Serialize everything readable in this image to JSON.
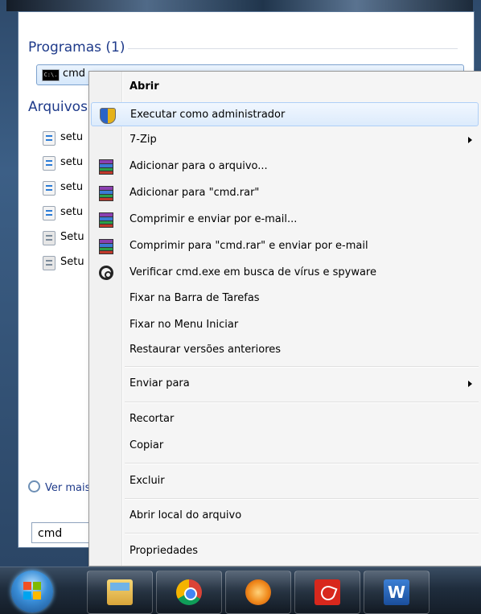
{
  "start_menu": {
    "programs_header": "Programas (1)",
    "files_header": "Arquivos",
    "program_item": "cmd",
    "program_icon_text": "C:\\.",
    "files": [
      "setu",
      "setu",
      "setu",
      "setu",
      "Setu",
      "Setu"
    ],
    "see_more": "Ver mais",
    "search_value": "cmd"
  },
  "context_menu": {
    "items": [
      {
        "label": "Abrir",
        "bold": true,
        "icon": null
      },
      {
        "label": "Executar como administrador",
        "icon": "uac-shield-icon",
        "highlighted": true
      },
      {
        "label": "7-Zip",
        "submenu": true,
        "icon": null
      },
      {
        "label": "Adicionar para o arquivo...",
        "icon": "winrar-icon"
      },
      {
        "label": "Adicionar para \"cmd.rar\"",
        "icon": "winrar-icon"
      },
      {
        "label": "Comprimir e enviar por e-mail...",
        "icon": "winrar-icon"
      },
      {
        "label": "Comprimir para \"cmd.rar\" e enviar por e-mail",
        "icon": "winrar-icon"
      },
      {
        "label": "Verificar cmd.exe em busca de vírus e spyware",
        "icon": "avg-icon"
      },
      {
        "label": "Fixar na Barra de Tarefas",
        "icon": null
      },
      {
        "label": "Fixar no Menu Iniciar",
        "icon": null
      },
      {
        "label": "Restaurar versões anteriores",
        "icon": null
      },
      {
        "label": "Enviar para",
        "submenu": true,
        "icon": null
      },
      {
        "label": "Recortar",
        "icon": null
      },
      {
        "label": "Copiar",
        "icon": null
      },
      {
        "label": "Excluir",
        "icon": null
      },
      {
        "label": "Abrir local do arquivo",
        "icon": null
      },
      {
        "label": "Propriedades",
        "icon": null
      }
    ]
  },
  "taskbar": {
    "apps": [
      "windows-explorer-icon",
      "chrome-icon",
      "orange-app-icon",
      "adobe-reader-icon",
      "word-icon"
    ],
    "word_letter": "W"
  },
  "colors": {
    "header_blue": "#1e3a8a",
    "highlight_border": "#aecff7"
  }
}
